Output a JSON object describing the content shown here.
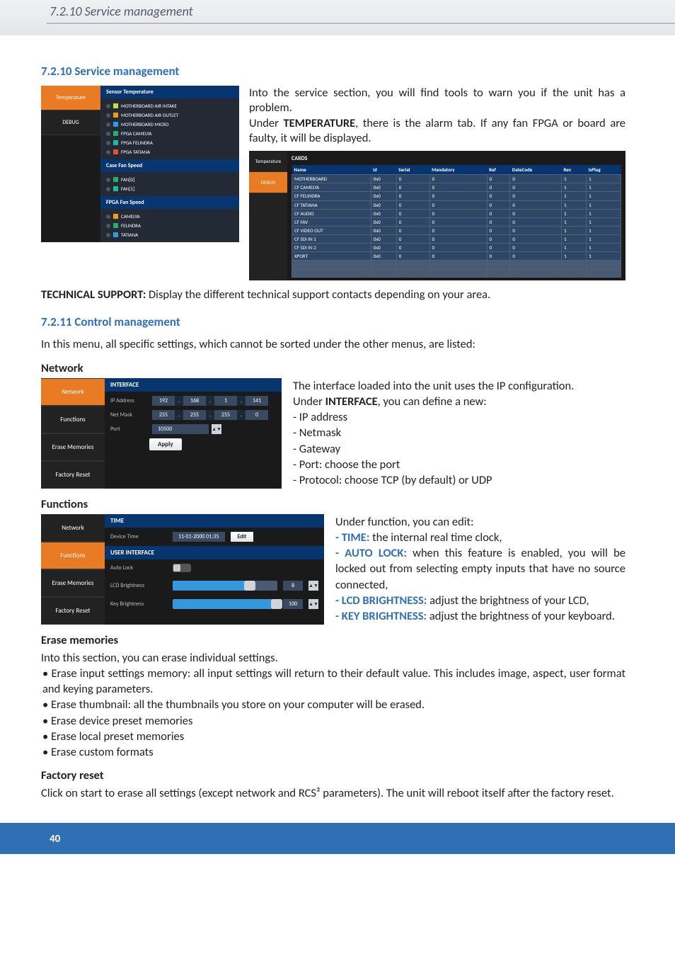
{
  "header": {
    "title": "7.2.10 Service management"
  },
  "section1": {
    "title": "7.2.10 Service management",
    "intro1": "Into the service section, you will find tools to warn you if the unit has a problem.",
    "intro2a": "Under ",
    "intro2b": "TEMPERATURE",
    "intro2c": ", there is the alarm tab. If any fan FPGA or board are faulty, it will be displayed.",
    "tech_label": "TECHNICAL SUPPORT:",
    "tech_text": " Display the different technical support contacts depending on your area."
  },
  "svc_panel": {
    "tabs": [
      "Temperature",
      "DEBUG"
    ],
    "groups": [
      {
        "title": "Sensor Temperature",
        "items": [
          {
            "c": "clr-y",
            "t": "MOTHERBOARD AIR INTAKE"
          },
          {
            "c": "clr-o",
            "t": "MOTHERBOARD AIR OUTLET"
          },
          {
            "c": "clr-b",
            "t": "MOTHERBOARD MICRO"
          },
          {
            "c": "clr-g",
            "t": "FPGA CAMELYA"
          },
          {
            "c": "clr-c",
            "t": "FPGA FELINDRA"
          },
          {
            "c": "clr-r",
            "t": "FPGA TATIANA"
          }
        ]
      },
      {
        "title": "Case Fan Speed",
        "items": [
          {
            "c": "clr-g",
            "t": "FAN[0]"
          },
          {
            "c": "clr-c",
            "t": "FAN[1]"
          }
        ]
      },
      {
        "title": "FPGA Fan Speed",
        "items": [
          {
            "c": "clr-o",
            "t": "CAMELYA"
          },
          {
            "c": "clr-g",
            "t": "FELINDRA"
          },
          {
            "c": "clr-b",
            "t": "TATIANA"
          }
        ]
      }
    ]
  },
  "card_table": {
    "tabs": [
      "Temperature",
      "DEBUG"
    ],
    "title": "CARDS",
    "cols": [
      "Name",
      "Id",
      "Serial",
      "Mandatory",
      "Ref",
      "DateCode",
      "Rev",
      "IsPlug"
    ],
    "rows": [
      [
        "MOTHERBOARD",
        "0x0",
        "0",
        "0",
        "0",
        "0",
        "1",
        "1"
      ],
      [
        "CF CAMELYA",
        "0x0",
        "0",
        "0",
        "0",
        "0",
        "1",
        "1"
      ],
      [
        "CF FELINDRA",
        "0x0",
        "0",
        "0",
        "0",
        "0",
        "1",
        "1"
      ],
      [
        "CF TATIANA",
        "0x0",
        "0",
        "0",
        "0",
        "0",
        "1",
        "1"
      ],
      [
        "CF AUDIO",
        "0x0",
        "0",
        "0",
        "0",
        "0",
        "1",
        "1"
      ],
      [
        "CF FAV",
        "0x0",
        "0",
        "0",
        "0",
        "0",
        "1",
        "1"
      ],
      [
        "CF VIDEO OUT",
        "0x0",
        "0",
        "0",
        "0",
        "0",
        "1",
        "1"
      ],
      [
        "CF SDI IN 1",
        "0x0",
        "0",
        "0",
        "0",
        "0",
        "1",
        "1"
      ],
      [
        "CF SDI IN 2",
        "0x0",
        "0",
        "0",
        "0",
        "0",
        "1",
        "1"
      ],
      [
        "XPORT",
        "0x0",
        "0",
        "0",
        "0",
        "0",
        "1",
        "1"
      ]
    ]
  },
  "section2": {
    "title": "7.2.11 Control management",
    "intro": "In this menu, all specific settings, which cannot be sorted under the other menus, are listed:"
  },
  "network": {
    "title": "Network",
    "tabs": [
      "Network",
      "Functions",
      "Erase Memories",
      "Factory Reset"
    ],
    "head": "INTERFACE",
    "ip_lbl": "IP Address",
    "ip": [
      "192",
      ".",
      "168",
      ".",
      "1",
      ".",
      "141"
    ],
    "nm_lbl": "Net Mask",
    "nm": [
      "255",
      ".",
      "255",
      ".",
      "255",
      ".",
      "0"
    ],
    "port_lbl": "Port",
    "port": "10500",
    "apply": "Apply",
    "text1": "The interface loaded into the unit uses the IP configuration.",
    "text2a": "Under ",
    "text2b": "INTERFACE",
    "text2c": ", you can define a new:",
    "bul": [
      "- IP address",
      "- Netmask",
      "- Gateway",
      "- Port: choose the port",
      "- Protocol: choose TCP (by default) or UDP"
    ]
  },
  "functions": {
    "title": "Functions",
    "tabs": [
      "Network",
      "Functions",
      "Erase Memories",
      "Factory Reset"
    ],
    "time_head": "TIME",
    "dt_lbl": "Device Time",
    "dt_val": "11-01-2000 01:35",
    "edit": "Edit",
    "ui_head": "USER INTERFACE",
    "al_lbl": "Auto Lock",
    "lcd_lbl": "LCD Brightness",
    "lcd_val": "8",
    "lcd_pct": "70",
    "key_lbl": "Key Brightness",
    "key_val": "100",
    "key_pct": "98",
    "text_intro": "Under function, you can edit:",
    "item1a": "TIME:",
    "item1b": " the internal real time clock,",
    "item2a": "AUTO LOCK:",
    "item2b": " when this feature is enabled, you will be locked out from selecting empty inputs that have no source connected,",
    "item3a": "LCD BRIGHTNESS:",
    "item3b": " adjust the brightness of your LCD,",
    "item4a": "KEY BRIGHTNESS:",
    "item4b": " adjust the brightness of your keyboard."
  },
  "erase": {
    "title": "Erase memories",
    "intro": "Into this section, you can erase individual settings.",
    "items": [
      "Erase input settings memory: all input settings will return to their default value. This includes image, aspect, user format and keying parameters.",
      "Erase thumbnail: all the thumbnails you store on your computer will be erased.",
      "Erase device preset memories",
      "Erase local preset memories",
      "Erase custom formats"
    ]
  },
  "factory": {
    "title": "Factory reset",
    "text": "Click on start to erase all settings (except network and RCS² parameters). The unit will reboot itself after the factory reset."
  },
  "page": "40"
}
